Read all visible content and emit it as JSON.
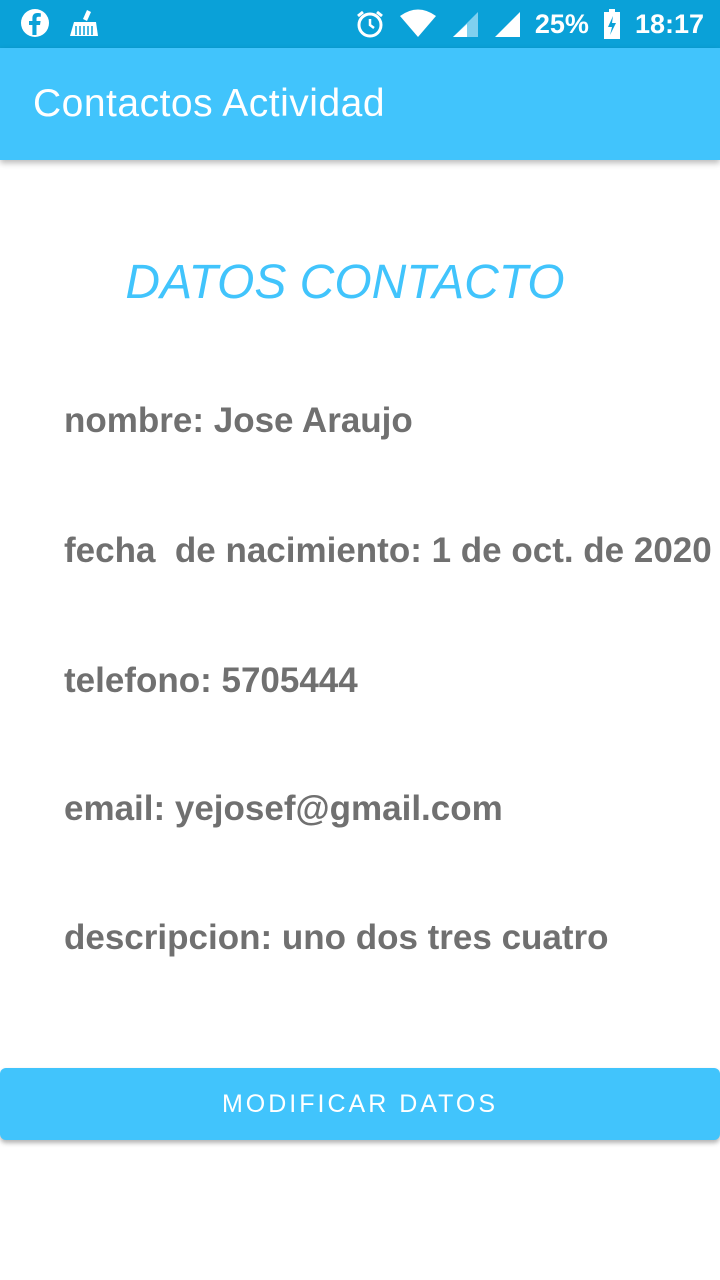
{
  "status_bar": {
    "battery": "25%",
    "time": "18:17",
    "left_icons": [
      "facebook-icon",
      "cleaner-icon"
    ],
    "right_icons": [
      "alarm-icon",
      "wifi-icon",
      "signal-icon",
      "signal-icon",
      "battery-charging-icon"
    ]
  },
  "app_bar": {
    "title": "Contactos Actividad"
  },
  "main": {
    "heading": "DATOS CONTACTO",
    "fields": {
      "nombre": "nombre: Jose Araujo",
      "fecha": "fecha  de nacimiento: 1 de oct. de 2020",
      "telefono": "telefono: 5705444",
      "email": "email: yejosef@gmail.com",
      "descripcion": "descripcion: uno dos tres cuatro"
    },
    "button_label": "MODIFICAR DATOS"
  },
  "colors": {
    "status_bar": "#0aa1d8",
    "primary": "#41c4fc",
    "text_gray": "#707070",
    "background": "#ffffff"
  }
}
